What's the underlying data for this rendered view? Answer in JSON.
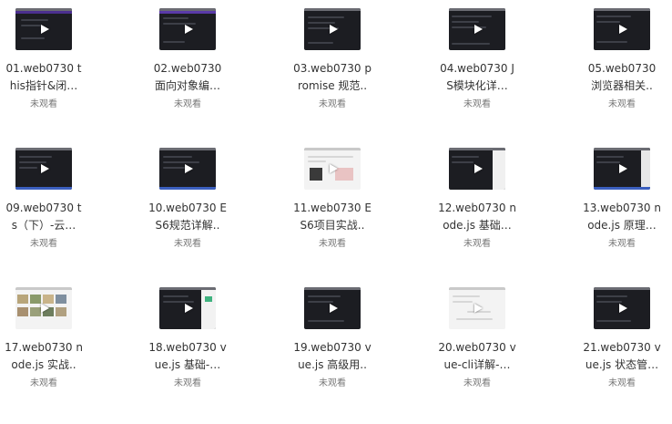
{
  "videos": [
    {
      "line1": "01.web0730 t",
      "line2": "his指针&闭…",
      "status": "未观看"
    },
    {
      "line1": "02.web0730",
      "line2": "面向对象编…",
      "status": "未观看"
    },
    {
      "line1": "03.web0730 p",
      "line2": "romise 规范..",
      "status": "未观看"
    },
    {
      "line1": "04.web0730 J",
      "line2": "S模块化详…",
      "status": "未观看"
    },
    {
      "line1": "05.web0730",
      "line2": "浏览器相关..",
      "status": "未观看"
    },
    {
      "line1": "09.web0730 t",
      "line2": "s（下）-云…",
      "status": "未观看"
    },
    {
      "line1": "10.web0730 E",
      "line2": "S6规范详解..",
      "status": "未观看"
    },
    {
      "line1": "11.web0730 E",
      "line2": "S6项目实战..",
      "status": "未观看"
    },
    {
      "line1": "12.web0730 n",
      "line2": "ode.js 基础…",
      "status": "未观看"
    },
    {
      "line1": "13.web0730 n",
      "line2": "ode.js 原理…",
      "status": "未观看"
    },
    {
      "line1": "17.web0730 n",
      "line2": "ode.js 实战..",
      "status": "未观看"
    },
    {
      "line1": "18.web0730 v",
      "line2": "ue.js 基础-…",
      "status": "未观看"
    },
    {
      "line1": "19.web0730 v",
      "line2": "ue.js 高级用..",
      "status": "未观看"
    },
    {
      "line1": "20.web0730 v",
      "line2": "ue-cli详解-…",
      "status": "未观看"
    },
    {
      "line1": "21.web0730 v",
      "line2": "ue.js 状态管…",
      "status": "未观看"
    }
  ]
}
